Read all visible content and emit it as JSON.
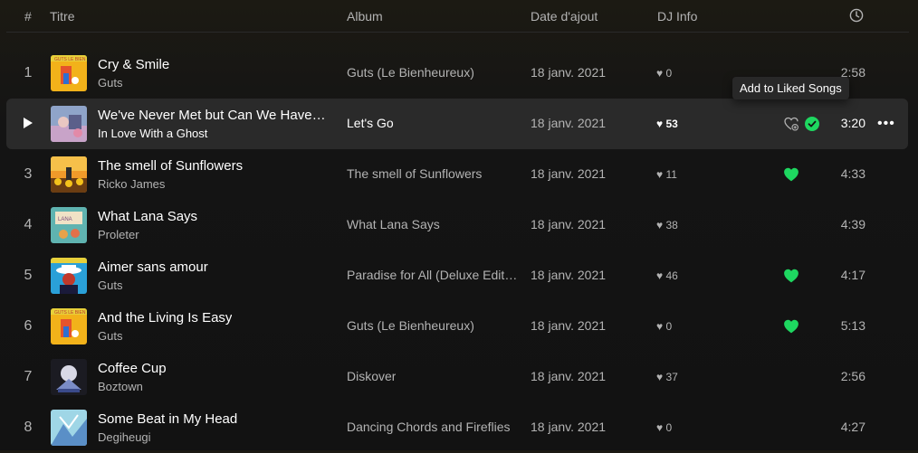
{
  "header": {
    "index": "#",
    "title": "Titre",
    "album": "Album",
    "date": "Date d'ajout",
    "dj": "DJ Info",
    "duration_icon": "clock-icon"
  },
  "tooltip": "Add to Liked Songs",
  "colors": {
    "accent": "#1ed760",
    "hover_row": "#2a2a2a"
  },
  "tracks": [
    {
      "index": "1",
      "title": "Cry & Smile",
      "artist": "Guts",
      "album": "Guts (Le Bienheureux)",
      "date": "18 janv. 2021",
      "dj": "♥ 0",
      "liked": false,
      "duration": "2:58"
    },
    {
      "index": "2",
      "title": "We've Never Met but Can We Have a Coffee or Something?",
      "artist": "In Love With a Ghost",
      "album": "Let's Go",
      "date": "18 janv. 2021",
      "dj": "♥ 53",
      "liked": false,
      "duration": "3:20",
      "hover": true
    },
    {
      "index": "3",
      "title": "The smell of Sunflowers",
      "artist": "Ricko James",
      "album": "The smell of Sunflowers",
      "date": "18 janv. 2021",
      "dj": "♥ 11",
      "liked": true,
      "duration": "4:33"
    },
    {
      "index": "4",
      "title": "What Lana Says",
      "artist": "Proleter",
      "album": "What Lana Says",
      "date": "18 janv. 2021",
      "dj": "♥ 38",
      "liked": false,
      "duration": "4:39"
    },
    {
      "index": "5",
      "title": "Aimer sans amour",
      "artist": "Guts",
      "album": "Paradise for All (Deluxe Edition)",
      "date": "18 janv. 2021",
      "dj": "♥ 46",
      "liked": true,
      "duration": "4:17"
    },
    {
      "index": "6",
      "title": "And the Living Is Easy",
      "artist": "Guts",
      "album": "Guts (Le Bienheureux)",
      "date": "18 janv. 2021",
      "dj": "♥ 0",
      "liked": true,
      "duration": "5:13"
    },
    {
      "index": "7",
      "title": "Coffee Cup",
      "artist": "Boztown",
      "album": "Diskover",
      "date": "18 janv. 2021",
      "dj": "♥ 37",
      "liked": false,
      "duration": "2:56"
    },
    {
      "index": "8",
      "title": "Some Beat in My Head",
      "artist": "Degiheugi",
      "album": "Dancing Chords and Fireflies",
      "date": "18 janv. 2021",
      "dj": "♥ 0",
      "liked": false,
      "duration": "4:27"
    }
  ]
}
